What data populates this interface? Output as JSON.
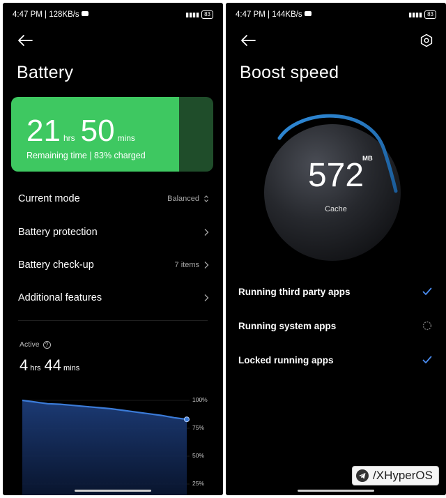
{
  "left": {
    "status": {
      "time_speed": "4:47 PM | 128KB/s",
      "battery": "83"
    },
    "title": "Battery",
    "card": {
      "hours": "21",
      "hours_unit": "hrs",
      "mins": "50",
      "mins_unit": "mins",
      "subtitle": "Remaining time | 83% charged",
      "charge_percent": 83,
      "fill_color": "#3ec861"
    },
    "rows": [
      {
        "label": "Current mode",
        "value": "Balanced"
      },
      {
        "label": "Battery protection",
        "value": ""
      },
      {
        "label": "Battery check-up",
        "value": "7 items"
      },
      {
        "label": "Additional features",
        "value": ""
      }
    ],
    "active": {
      "label": "Active",
      "hours": "4",
      "hours_unit": "hrs",
      "mins": "44",
      "mins_unit": "mins"
    },
    "chart_data": {
      "type": "area",
      "y_ticks": [
        "100%",
        "75%",
        "50%",
        "25%"
      ],
      "ylim": [
        25,
        100
      ],
      "values": [
        100,
        98.5,
        97,
        96.5,
        95.5,
        94.5,
        93.5,
        92.5,
        91,
        89.5,
        88,
        86.5,
        84.5,
        83
      ],
      "color": "#3b7bd8"
    }
  },
  "right": {
    "status": {
      "time_speed": "4:47 PM | 144KB/s",
      "battery": "83"
    },
    "title": "Boost speed",
    "cache": {
      "value": "572",
      "unit": "MB",
      "label": "Cache"
    },
    "options": [
      {
        "label": "Running third party apps",
        "state": "checked"
      },
      {
        "label": "Running system apps",
        "state": "loading"
      },
      {
        "label": "Locked running apps",
        "state": "checked"
      }
    ],
    "accent": "#4a8cf0"
  },
  "watermark": {
    "text": "/XHyperOS"
  }
}
